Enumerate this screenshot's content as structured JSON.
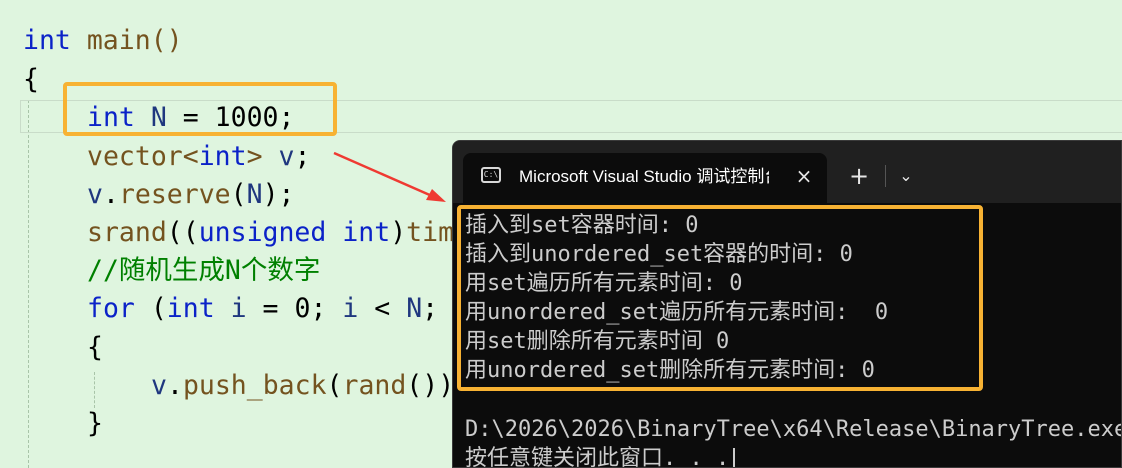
{
  "editor": {
    "lines": [
      {
        "t1": "int",
        "t2": " main()"
      },
      {
        "brace": "{"
      },
      {
        "kw": "int",
        "var": " N",
        "op": " = ",
        "num": "1000",
        "end": ";"
      },
      {
        "a": "vector<",
        "kw": "int",
        "b": "> ",
        "var": "v",
        "end": ";"
      },
      {
        "var": "v",
        "dot": ".",
        "fn": "reserve",
        "open": "(",
        "arg": "N",
        "close": ");"
      },
      {
        "fn": "srand",
        "open": "((",
        "kw1": "unsigned",
        "sp": " ",
        "kw2": "int",
        "close": ")",
        "fn2": "tim"
      },
      {
        "comment": "//随机生成N个数字"
      },
      {
        "kw": "for",
        "a": " (",
        "kw2": "int",
        "var": " i",
        "b": " = ",
        "num": "0",
        "c": "; ",
        "var2": "i",
        "d": " < ",
        "var3": "N",
        "e": ";"
      },
      {
        "brace": "{"
      },
      {
        "var": "v",
        "dot": ".",
        "fn": "push_back",
        "open": "(",
        "fn2": "rand",
        "close": "())"
      },
      {
        "brace": "}"
      }
    ]
  },
  "console": {
    "tab_title": "Microsoft Visual Studio 调试控制台",
    "tab_icon_label": "C:\\",
    "close_icon": "×",
    "new_tab_icon": "+",
    "dropdown_icon": "⌄",
    "output": [
      "插入到set容器时间: 0",
      "插入到unordered_set容器的时间: 0",
      "用set遍历所有元素时间: 0",
      "用unordered_set遍历所有元素时间:  0",
      "用set删除所有元素时间 0",
      "用unordered_set删除所有元素时间: 0"
    ],
    "path_line": "D:\\2026\\2026\\BinaryTree\\x64\\Release\\BinaryTree.exe",
    "prompt_line": "按任意键关闭此窗口. . ."
  }
}
